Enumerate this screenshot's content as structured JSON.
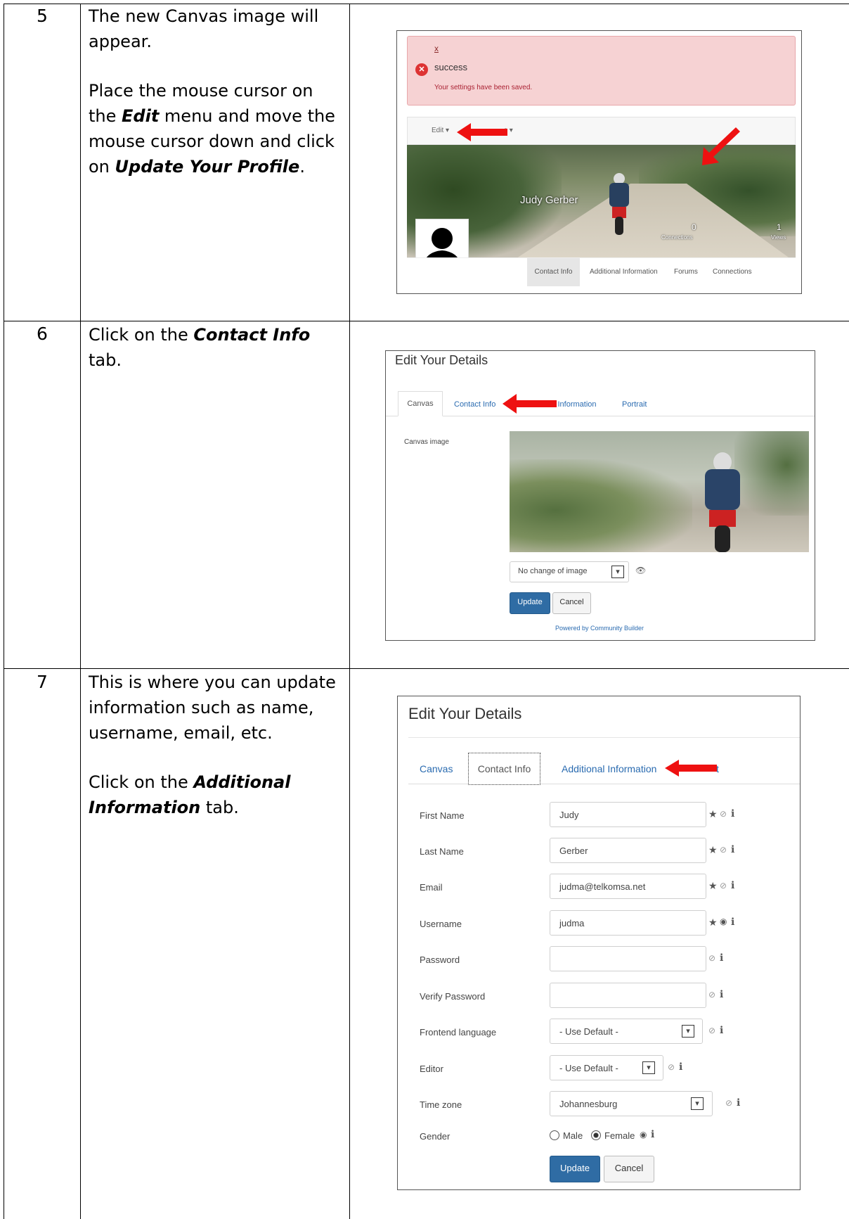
{
  "steps": [
    {
      "num": "5",
      "text1": "The new Canvas image will appear.",
      "text2_pre": "Place the mouse cursor on the ",
      "text2_b1": "Edit",
      "text2_mid": " menu and move the mouse cursor down and click on ",
      "text2_b2": "Update Your Profile",
      "text2_post": "."
    },
    {
      "num": "6",
      "text_pre": "Click on the ",
      "text_b": "Contact Info",
      "text_post": " tab."
    },
    {
      "num": "7",
      "text1": "This is where you can update information such as name, username, email, etc.",
      "text2_pre": "Click on the ",
      "text2_b": "Additional Information",
      "text2_post": " tab."
    }
  ],
  "shot5": {
    "close_x": "x",
    "alert_title": "success",
    "alert_msg": "Your settings have been saved.",
    "edit_menu": "Edit ▾",
    "menu2_partial": "s ▾",
    "user_name": "Judy Gerber",
    "connections_count": "0",
    "connections_label": "Connections",
    "views_count": "1",
    "views_label": "Views",
    "tabs": [
      "Contact Info",
      "Additional Information",
      "Forums",
      "Connections"
    ]
  },
  "shot6": {
    "title": "Edit Your Details",
    "tabs": [
      "Canvas",
      "Contact Info",
      "l Information",
      "Portrait"
    ],
    "field_label": "Canvas image",
    "select_value": "No change of image",
    "update": "Update",
    "cancel": "Cancel",
    "powered": "Powered by Community Builder"
  },
  "shot7": {
    "title": "Edit Your Details",
    "tabs": [
      "Canvas",
      "Contact Info",
      "Additional Information",
      "t"
    ],
    "fields": [
      {
        "label": "First Name",
        "value": "Judy"
      },
      {
        "label": "Last Name",
        "value": "Gerber"
      },
      {
        "label": "Email",
        "value": "judma@telkomsa.net"
      },
      {
        "label": "Username",
        "value": "judma"
      },
      {
        "label": "Password",
        "value": ""
      },
      {
        "label": "Verify Password",
        "value": ""
      },
      {
        "label": "Frontend language",
        "value": "- Use Default -"
      },
      {
        "label": "Editor",
        "value": "- Use Default -"
      },
      {
        "label": "Time zone",
        "value": "Johannesburg"
      }
    ],
    "gender_label": "Gender",
    "gender_male": "Male",
    "gender_female": "Female",
    "update": "Update",
    "cancel": "Cancel"
  },
  "colors": {
    "arrow": "#ee1111",
    "link": "#2a6bb0",
    "primary_button": "#2f6ca4",
    "alert_bg": "#f8d7da"
  }
}
